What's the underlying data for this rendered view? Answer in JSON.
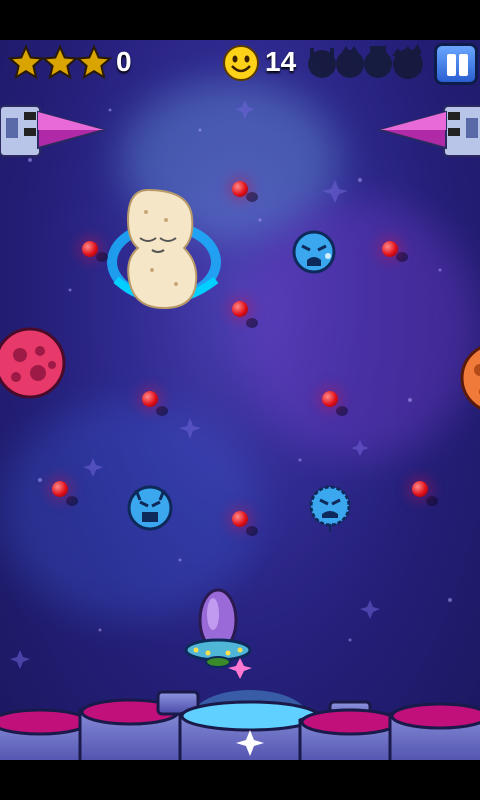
{
  "hud": {
    "stars_earned": 3,
    "stars_total": 3,
    "score": "0",
    "smiley_count": "14",
    "monsters_remaining_icons": 4
  },
  "icons": {
    "star": "star-icon",
    "smiley": "smiley-icon",
    "pause": "pause-icon",
    "monster": "monster-silhouette-icon"
  },
  "colors": {
    "star": "#d9a400",
    "smiley": "#ffd21a",
    "red_peg": "#e0101a",
    "blue_monster": "#3aa7ee",
    "pink_asteroid": "#e83a6a",
    "orange_asteroid": "#f07a3a",
    "sky": "#2f2a8f"
  }
}
